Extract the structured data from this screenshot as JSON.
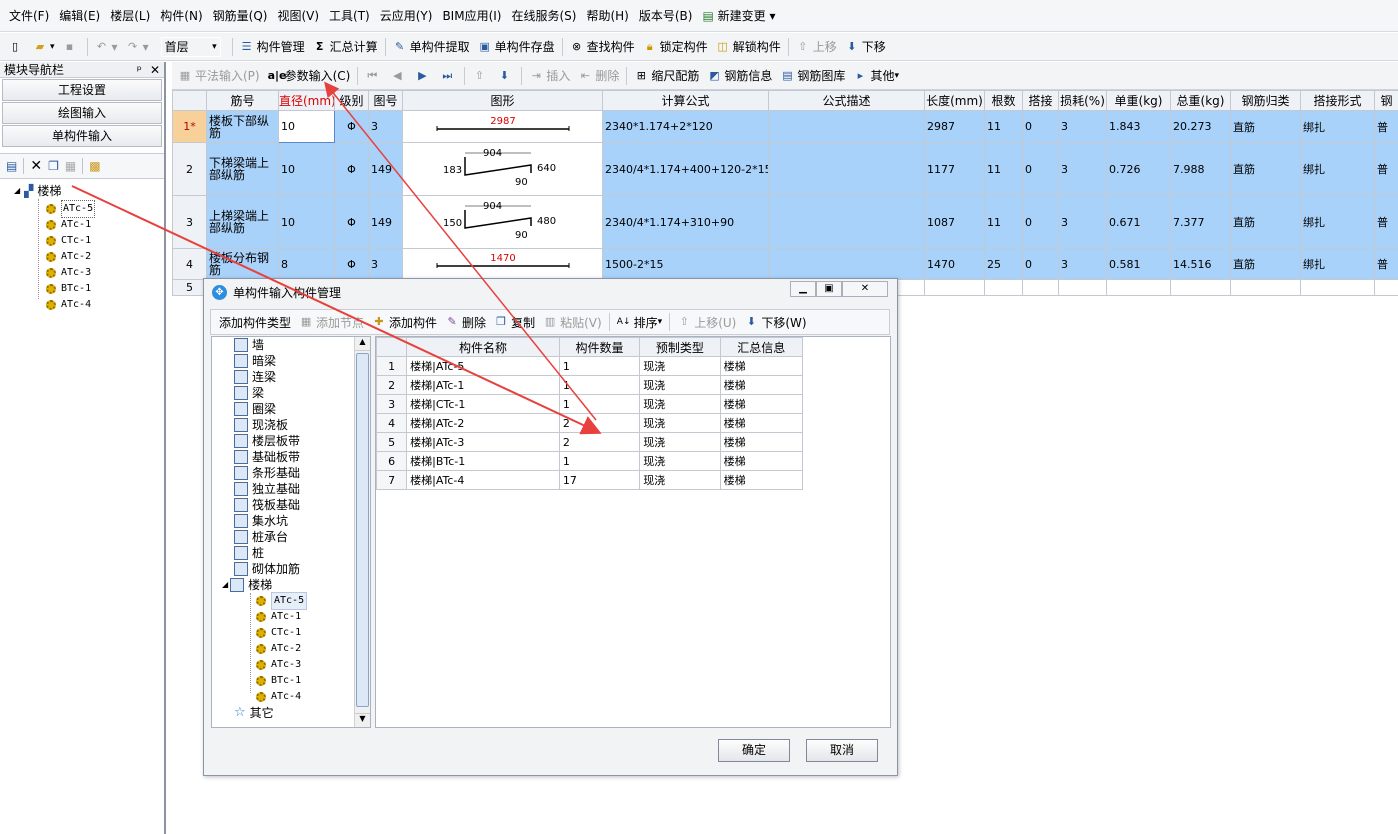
{
  "menu": [
    "文件(F)",
    "编辑(E)",
    "楼层(L)",
    "构件(N)",
    "钢筋量(Q)",
    "视图(V)",
    "工具(T)",
    "云应用(Y)",
    "BIM应用(I)",
    "在线服务(S)",
    "帮助(H)",
    "版本号(B)",
    "新建变更"
  ],
  "toolbar": {
    "floor": "首层",
    "component_manage": "构件管理",
    "sum_calc": "汇总计算",
    "single_extract": "单构件提取",
    "single_save": "单构件存盘",
    "find": "查找构件",
    "lock": "锁定构件",
    "unlock": "解锁构件",
    "move_up": "上移",
    "move_down": "下移"
  },
  "nav": {
    "title": "模块导航栏",
    "pin": "ᵖ",
    "close": "✕",
    "btn_project": "工程设置",
    "btn_draw": "绘图输入",
    "btn_single": "单构件输入",
    "tree_root": "楼梯",
    "tree_items": [
      "ATc-5",
      "ATc-1",
      "CTc-1",
      "ATc-2",
      "ATc-3",
      "BTc-1",
      "ATc-4"
    ]
  },
  "subtoolbar": {
    "flat_input": "平法输入(P)",
    "param_input": "参数输入(C)",
    "insert": "插入",
    "delete": "删除",
    "scale_rebar": "缩尺配筋",
    "rebar_info": "钢筋信息",
    "rebar_lib": "钢筋图库",
    "other": "其他"
  },
  "grid": {
    "headers": [
      "筋号",
      "直径(mm)",
      "级别",
      "图号",
      "图形",
      "计算公式",
      "公式描述",
      "长度(mm)",
      "根数",
      "搭接",
      "损耗(%)",
      "单重(kg)",
      "总重(kg)",
      "钢筋归类",
      "搭接形式",
      "钢"
    ],
    "rows": [
      {
        "no": "1*",
        "name": "楼板下部纵筋",
        "dia": "10",
        "grade": "Φ",
        "fig": "3",
        "shape": "2987",
        "formula": "2340*1.174+2*120",
        "desc": "",
        "len": "2987",
        "count": "11",
        "lap": "0",
        "loss": "3",
        "unit": "1.843",
        "total": "20.273",
        "cat": "直筋",
        "laptype": "绑扎",
        "extra": "普"
      },
      {
        "no": "2",
        "name": "下梯梁端上部纵筋",
        "dia": "10",
        "grade": "Φ",
        "fig": "149",
        "shape_a": "183",
        "shape_b": "904",
        "shape_c": "640",
        "shape_d": "90",
        "formula": "2340/4*1.174+400+120-2*15",
        "desc": "",
        "len": "1177",
        "count": "11",
        "lap": "0",
        "loss": "3",
        "unit": "0.726",
        "total": "7.988",
        "cat": "直筋",
        "laptype": "绑扎",
        "extra": "普"
      },
      {
        "no": "3",
        "name": "上梯梁端上部纵筋",
        "dia": "10",
        "grade": "Φ",
        "fig": "149",
        "shape_a": "150",
        "shape_b": "904",
        "shape_c": "480",
        "shape_d": "90",
        "formula": "2340/4*1.174+310+90",
        "desc": "",
        "len": "1087",
        "count": "11",
        "lap": "0",
        "loss": "3",
        "unit": "0.671",
        "total": "7.377",
        "cat": "直筋",
        "laptype": "绑扎",
        "extra": "普"
      },
      {
        "no": "4",
        "name": "楼板分布钢筋",
        "dia": "8",
        "grade": "Φ",
        "fig": "3",
        "shape": "1470",
        "formula": "1500-2*15",
        "desc": "",
        "len": "1470",
        "count": "25",
        "lap": "0",
        "loss": "3",
        "unit": "0.581",
        "total": "14.516",
        "cat": "直筋",
        "laptype": "绑扎",
        "extra": "普"
      }
    ],
    "empty_row_no": "5"
  },
  "dialog": {
    "title": "单构件输入构件管理",
    "tools": {
      "add_type": "添加构件类型",
      "add_node": "添加节点",
      "add_comp": "添加构件",
      "delete": "删除",
      "copy": "复制",
      "paste": "粘贴(V)",
      "sort": "排序",
      "up": "上移(U)",
      "down": "下移(W)"
    },
    "tree": [
      "墙",
      "暗梁",
      "连梁",
      "梁",
      "圈梁",
      "现浇板",
      "楼层板带",
      "基础板带",
      "条形基础",
      "独立基础",
      "筏板基础",
      "集水坑",
      "桩承台",
      "桩",
      "砌体加筋",
      "楼梯"
    ],
    "tree_children": [
      "ATc-5",
      "ATc-1",
      "CTc-1",
      "ATc-2",
      "ATc-3",
      "BTc-1",
      "ATc-4"
    ],
    "tree_last": "其它",
    "table_headers": [
      "",
      "构件名称",
      "构件数量",
      "预制类型",
      "汇总信息"
    ],
    "table_rows": [
      [
        "1",
        "楼梯|ATc-5",
        "1",
        "现浇",
        "楼梯"
      ],
      [
        "2",
        "楼梯|ATc-1",
        "1",
        "现浇",
        "楼梯"
      ],
      [
        "3",
        "楼梯|CTc-1",
        "1",
        "现浇",
        "楼梯"
      ],
      [
        "4",
        "楼梯|ATc-2",
        "2",
        "现浇",
        "楼梯"
      ],
      [
        "5",
        "楼梯|ATc-3",
        "2",
        "现浇",
        "楼梯"
      ],
      [
        "6",
        "楼梯|BTc-1",
        "1",
        "现浇",
        "楼梯"
      ],
      [
        "7",
        "楼梯|ATc-4",
        "17",
        "现浇",
        "楼梯"
      ]
    ],
    "ok": "确定",
    "cancel": "取消"
  }
}
